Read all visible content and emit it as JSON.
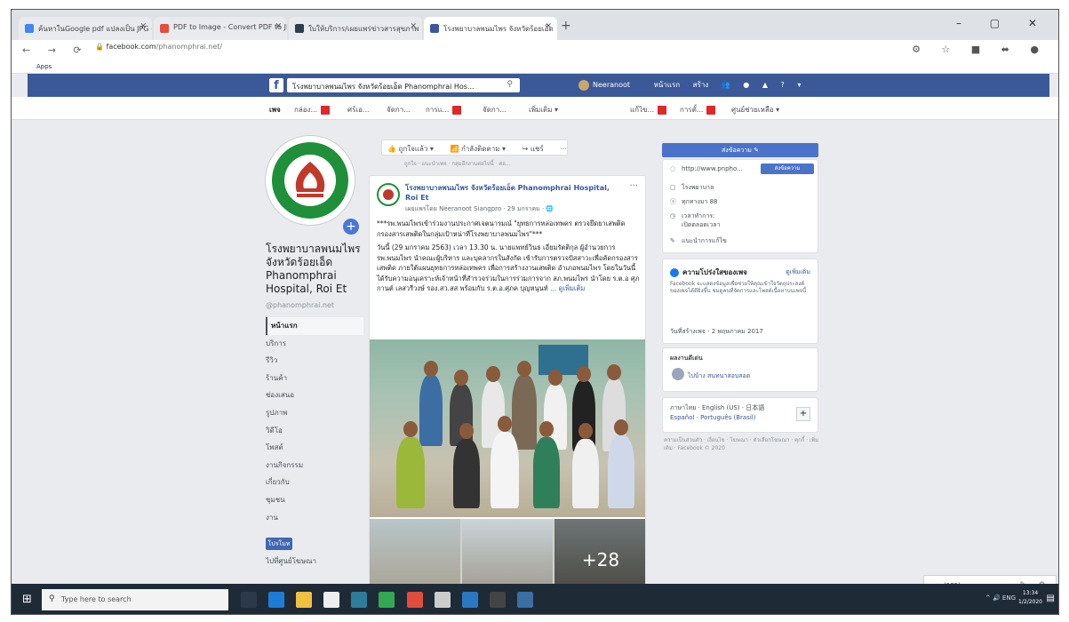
{
  "browser": {
    "tabs": [
      {
        "label": "ค้นหาในGoogle pdf แปลงเป็น JPG - ค้นหาด้วย Google",
        "color": "#4285f4"
      },
      {
        "label": "PDF to Image - Convert PDF to JPG",
        "color": "#e74c3c"
      },
      {
        "label": "ใบให้บริการ/เผยแพร่ข่าวสารสุขภาพ",
        "color": "#2c3e50"
      },
      {
        "label": "โรงพยาบาลพนมไพร จังหวัดร้อยเอ็ด",
        "color": "#3b5998"
      }
    ],
    "new_tab": "+",
    "url_domain": "facebook.com",
    "url_path": "/phanomphrai.net/",
    "bookmarks_label": "Apps",
    "window_controls": "– ▢ ✕"
  },
  "fb": {
    "logo": "f",
    "search_value": "โรงพยาบาลพนมไพร จังหวัดร้อยเอ็ด Phanomphrai Hos...",
    "user_name": "Neeranoot",
    "nav_home": "หน้าแรก",
    "nav_create": "สร้าง"
  },
  "page_nav": {
    "items": [
      "เพจ",
      "กล่อง...",
      "ศร์เอ...",
      "จัดกา...",
      "การแ...",
      "จัดกา...",
      "เพิ่มเติม ▾"
    ],
    "right": [
      "แก้ไข...",
      "การตั้...",
      "ศูนย์ช่วยเหลือ ▾"
    ]
  },
  "profile": {
    "name": "โรงพยาบาลพนมไพร จังหวัดร้อยเอ็ด Phanomphrai Hospital, Roi Et",
    "handle": "@phanomphrai.net",
    "menu": [
      "หน้าแรก",
      "บริการ",
      "รีวิว",
      "ร้านค้า",
      "ช่องเสนอ",
      "รูปภาพ",
      "วิดีโอ",
      "โพสต์",
      "งานกิจกรรม",
      "เกี่ยวกับ",
      "ชุมชน",
      "งาน"
    ],
    "promote": "โปรโมท",
    "ad_center": "ไปที่ศูนย์โฆษณา"
  },
  "actions": {
    "liked": "ถูกใจแล้ว ▾",
    "following": "กำลังติดตาม ▾",
    "share": "แชร์",
    "more": "···",
    "subtext": "ถูกใจ · แนะนำเพจ · กลุ่มอีกงานต่อไปนี้ · ต่อ..."
  },
  "post": {
    "author": "โรงพยาบาลพนมไพร จังหวัดร้อยเอ็ด Phanomphrai Hospital, Roi Et",
    "meta": "เผยแพร่โดย Neeranoot Siangpro · 29 มกราคม · 🌐",
    "dots": "···",
    "para1": "***รพ.พนมไพรเข้าร่วมงานประกาศเจตนารมณ์ \"ยุทธการหล่อเทพคร ตรวจยึดยาเสพติดกรองสารเสพติดในกลุ่มเป้าหน่าที่โรงพยาบาลพนมไพร\"***",
    "para2": "วันนี้ (29 มกราคม 2563) เวลา 13.30 น. นายแพทย์วินธ เอี่ยมรัตติกุล ผู้อำนวยการ รพ.พนมไพร นำคณะผู้บริหาร และบุคลากรในสังกัด เข้ารับการตรวจปัสสาวะเพื่อคัดกรองสารเสพติด ภายใต้แผนยุทธการหล่อเทพคร เพื่อการสร้างงานเสพติด อำเภอพนมไพร โดยในวันนี้ได้รับความอนุเคราะห์เจ้าหน้าที่สำรวจร่วมในการร่วมการจาก สภ.พนมไพร นำโดย ร.ต.อ ศุภกานต์ เลสวรีวงษ์ รอง.สว.สส พร้อมกับ ร.ต.อ.ศุภค บุญหนุนท์",
    "see_more": "... ดูเพิ่มเติม",
    "more_photos": "+28"
  },
  "right": {
    "edit_button": "ส่งข้อความ ✎",
    "website": "http://www.pnpho...",
    "send_message": "ส่งข้อความ",
    "category": "โรงพยาบาล",
    "rating": "ทุกทางมา 88",
    "hours_label": "เวลาทำการ:",
    "hours_status": "เปิดตลอดเวลา",
    "suggest": "แนะนำการแก้ไข",
    "transparency_title": "ความโปร่งใสของเพจ",
    "transparency_link": "ดูเพิ่มเติม",
    "transparency_text": "Facebook จะแสดงข้อมูลเพื่อช่วยให้คุณเข้าใจวัตถุประสงค์ของเพจได้ดียิ่งขึ้น ชมดูคนที่จัดการและโพสต์เนื้อหาบนเพจนี้",
    "created": "วันที่สร้างเพจ - 2 พฤษภาคม 2017",
    "admin_title": "ผลงานดีเด่น",
    "admin_name": "ไปบ้าง สนทนาสอบสอด",
    "lang_line1": "ภาษาไทย · English (US) · 日本語",
    "lang_line2": "Español · Português (Brasil)",
    "footer": "ความเป็นส่วนตัว · เงื่อนไข · โฆษณา · ตัวเลือกโฆษณา · คุกกี้ · เพิ่มเติม · Facebook © 2020"
  },
  "chat": {
    "label": "แชท (101)",
    "icons": "✎ ⚙"
  },
  "taskbar": {
    "search": "Type here to search",
    "time": "13:34",
    "date": "1/2/2020",
    "tray": "^ 🔊 ENG"
  }
}
